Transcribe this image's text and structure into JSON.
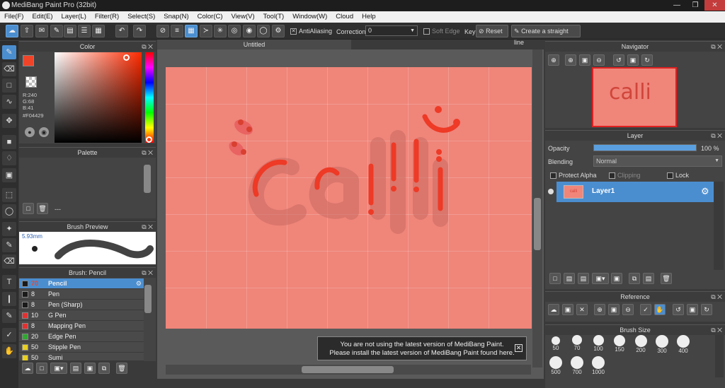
{
  "titlebar": {
    "title": "MediBang Paint Pro (32bit)"
  },
  "menu": [
    "File(F)",
    "Edit(E)",
    "Layer(L)",
    "Filter(R)",
    "Select(S)",
    "Snap(N)",
    "Color(C)",
    "View(V)",
    "Tool(T)",
    "Window(W)",
    "Cloud",
    "Help"
  ],
  "toolbar": {
    "antialiasing_label": "AntiAliasing",
    "correction_label": "Correction",
    "correction_value": "0",
    "soft_edge_label": "Soft Edge",
    "key_label": "Key",
    "reset_label": "Reset",
    "straight_line_label": "Create a straight line"
  },
  "color_panel": {
    "title": "Color",
    "r": "R:240",
    "g": "G:68",
    "b": "B:41",
    "hex": "#F04429",
    "primary_color": "#f04429"
  },
  "palette_panel": {
    "title": "Palette",
    "value": "---"
  },
  "brush_preview": {
    "title": "Brush Preview",
    "size": "5.93mm"
  },
  "brush_panel": {
    "title": "Brush: Pencil",
    "brushes": [
      {
        "size": "70",
        "name": "Pencil",
        "color": "#1a1a1a",
        "selected": true
      },
      {
        "size": "8",
        "name": "Pen",
        "color": "#1a1a1a"
      },
      {
        "size": "8",
        "name": "Pen (Sharp)",
        "color": "#1a1a1a"
      },
      {
        "size": "10",
        "name": "G Pen",
        "color": "#e53030"
      },
      {
        "size": "8",
        "name": "Mapping Pen",
        "color": "#e53030"
      },
      {
        "size": "20",
        "name": "Edge Pen",
        "color": "#2ea82e"
      },
      {
        "size": "50",
        "name": "Stipple Pen",
        "color": "#e8d020"
      },
      {
        "size": "50",
        "name": "Sumi",
        "color": "#e8d020"
      }
    ]
  },
  "document": {
    "tab_title": "Untitled",
    "canvas_text": "calli"
  },
  "notice": {
    "line1": "You are not using the latest version of MediBang Paint.",
    "line2": "Please install the latest version of MediBang Paint found here."
  },
  "navigator": {
    "title": "Navigator",
    "preview_text": "calli"
  },
  "layer_panel": {
    "title": "Layer",
    "opacity_label": "Opacity",
    "opacity_value": "100 %",
    "opacity_fraction": 1.0,
    "blending_label": "Blending",
    "blending_value": "Normal",
    "protect_alpha_label": "Protect Alpha",
    "clipping_label": "Clipping",
    "lock_label": "Lock",
    "layers": [
      {
        "name": "Layer1",
        "thumb_text": "calli"
      }
    ]
  },
  "reference_panel": {
    "title": "Reference"
  },
  "brush_size_panel": {
    "title": "Brush Size",
    "sizes": [
      "50",
      "70",
      "100",
      "150",
      "200",
      "300",
      "400",
      "500",
      "700",
      "1000"
    ]
  }
}
